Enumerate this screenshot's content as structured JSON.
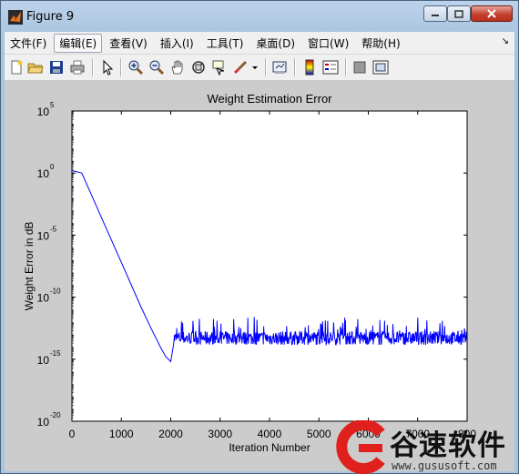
{
  "window": {
    "title": "Figure 9",
    "controls": {
      "minimize": "minimize",
      "maximize": "maximize",
      "close": "close"
    }
  },
  "menubar": {
    "items": [
      {
        "label": "文件(F)"
      },
      {
        "label": "编辑(E)",
        "active": true
      },
      {
        "label": "查看(V)"
      },
      {
        "label": "插入(I)"
      },
      {
        "label": "工具(T)"
      },
      {
        "label": "桌面(D)"
      },
      {
        "label": "窗口(W)"
      },
      {
        "label": "帮助(H)"
      }
    ],
    "overflow_glyph": "↘"
  },
  "toolbar": {
    "buttons": [
      "new-figure-icon",
      "open-file-icon",
      "save-icon",
      "print-icon",
      "edit-plot-arrow-icon",
      "zoom-in-icon",
      "zoom-out-icon",
      "pan-hand-icon",
      "rotate-3d-icon",
      "data-cursor-icon",
      "brush-icon",
      "brush-dropdown-icon",
      "link-plot-icon",
      "colorbar-icon",
      "legend-icon",
      "hide-plot-tools-icon",
      "show-plot-tools-icon"
    ]
  },
  "colors": {
    "line": "#0000ff",
    "figure_bg": "#cccccc",
    "axes_bg": "#ffffff"
  },
  "chart_data": {
    "type": "line",
    "title": "Weight Estimation Error",
    "xlabel": "Iteration Number",
    "ylabel": "Weight Error in dB",
    "xlim": [
      0,
      8000
    ],
    "ylim_exponents": [
      -20,
      5
    ],
    "y_scale": "log",
    "x_ticks": [
      0,
      1000,
      2000,
      3000,
      4000,
      5000,
      6000,
      7000,
      8000
    ],
    "x_tick_labels": [
      "0",
      "1000",
      "2000",
      "3000",
      "4000",
      "5000",
      "6000",
      "7000",
      "800"
    ],
    "y_ticks": [
      {
        "base": "10",
        "exp": "5"
      },
      {
        "base": "10",
        "exp": "0"
      },
      {
        "base": "10",
        "exp": "-5"
      },
      {
        "base": "10",
        "exp": "-10"
      },
      {
        "base": "10",
        "exp": "-15"
      },
      {
        "base": "10",
        "exp": "-20"
      }
    ],
    "grid": false,
    "series": [
      {
        "color": "#0000ff",
        "x": [
          0,
          200,
          400,
          600,
          800,
          1000,
          1200,
          1400,
          1600,
          1800,
          1900,
          2000,
          2050,
          2100,
          2500,
          3000,
          4000,
          5000,
          6000,
          7000,
          8000
        ],
        "log10_y": [
          0.2,
          0.0,
          -1.8,
          -3.6,
          -5.4,
          -7.2,
          -9.0,
          -10.8,
          -12.5,
          -14.1,
          -14.8,
          -15.2,
          -14.0,
          -13.5,
          -13.3,
          -13.3,
          -13.2,
          -13.3,
          -13.4,
          -13.3,
          -13.3
        ],
        "noise_start_x": 2050,
        "noise_band_log10": [
          -14.0,
          -10.3
        ]
      }
    ]
  },
  "watermark": {
    "brand": "谷速软件",
    "url": "www.gususoft.com"
  }
}
